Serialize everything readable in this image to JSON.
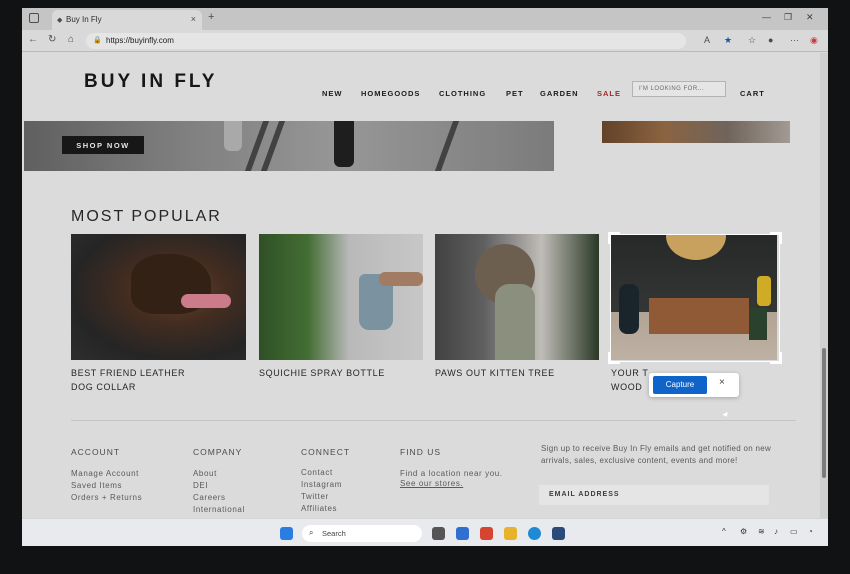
{
  "browser": {
    "tab_title": "Buy In Fly",
    "url": "https://buyinfly.com",
    "new_tab": "+",
    "close_tab": "×"
  },
  "site": {
    "logo": "BUY IN FLY",
    "nav": [
      "NEW",
      "HOMEGOODS",
      "CLOTHING",
      "PET",
      "GARDEN",
      "SALE"
    ],
    "search_placeholder": "I'M LOOKING FOR...",
    "cart": "CART",
    "hero_button": "SHOP NOW",
    "section_title": "MOST POPULAR",
    "products": [
      {
        "name_line1": "BEST FRIEND LEATHER",
        "name_line2": "DOG COLLAR"
      },
      {
        "name_line1": "SQUICHIE SPRAY BOTTLE",
        "name_line2": ""
      },
      {
        "name_line1": "PAWS OUT KITTEN TREE",
        "name_line2": ""
      },
      {
        "name_line1": "YOUR T",
        "name_line2": "WOOD"
      }
    ]
  },
  "footer": {
    "account": {
      "heading": "ACCOUNT",
      "links": [
        "Manage Account",
        "Saved Items",
        "Orders + Returns"
      ]
    },
    "company": {
      "heading": "COMPANY",
      "links": [
        "About",
        "DEI",
        "Careers",
        "International"
      ]
    },
    "connect": {
      "heading": "CONNECT",
      "links": [
        "Contact",
        "Instagram",
        "Twitter",
        "Affiliates"
      ]
    },
    "find_us": {
      "heading": "FIND US",
      "text": "Find a location near you.",
      "link": "See our stores."
    },
    "signup_text": "Sign up to receive Buy In Fly emails and get notified on new arrivals, sales, exclusive content, events and more!",
    "email_placeholder": "EMAIL ADDRESS"
  },
  "snip_toolbar": {
    "capture_label": "Capture",
    "close": "×"
  },
  "taskbar": {
    "search_label": "Search"
  },
  "colors": {
    "sale": "#b0312f",
    "capture_button": "#0f63c9"
  }
}
